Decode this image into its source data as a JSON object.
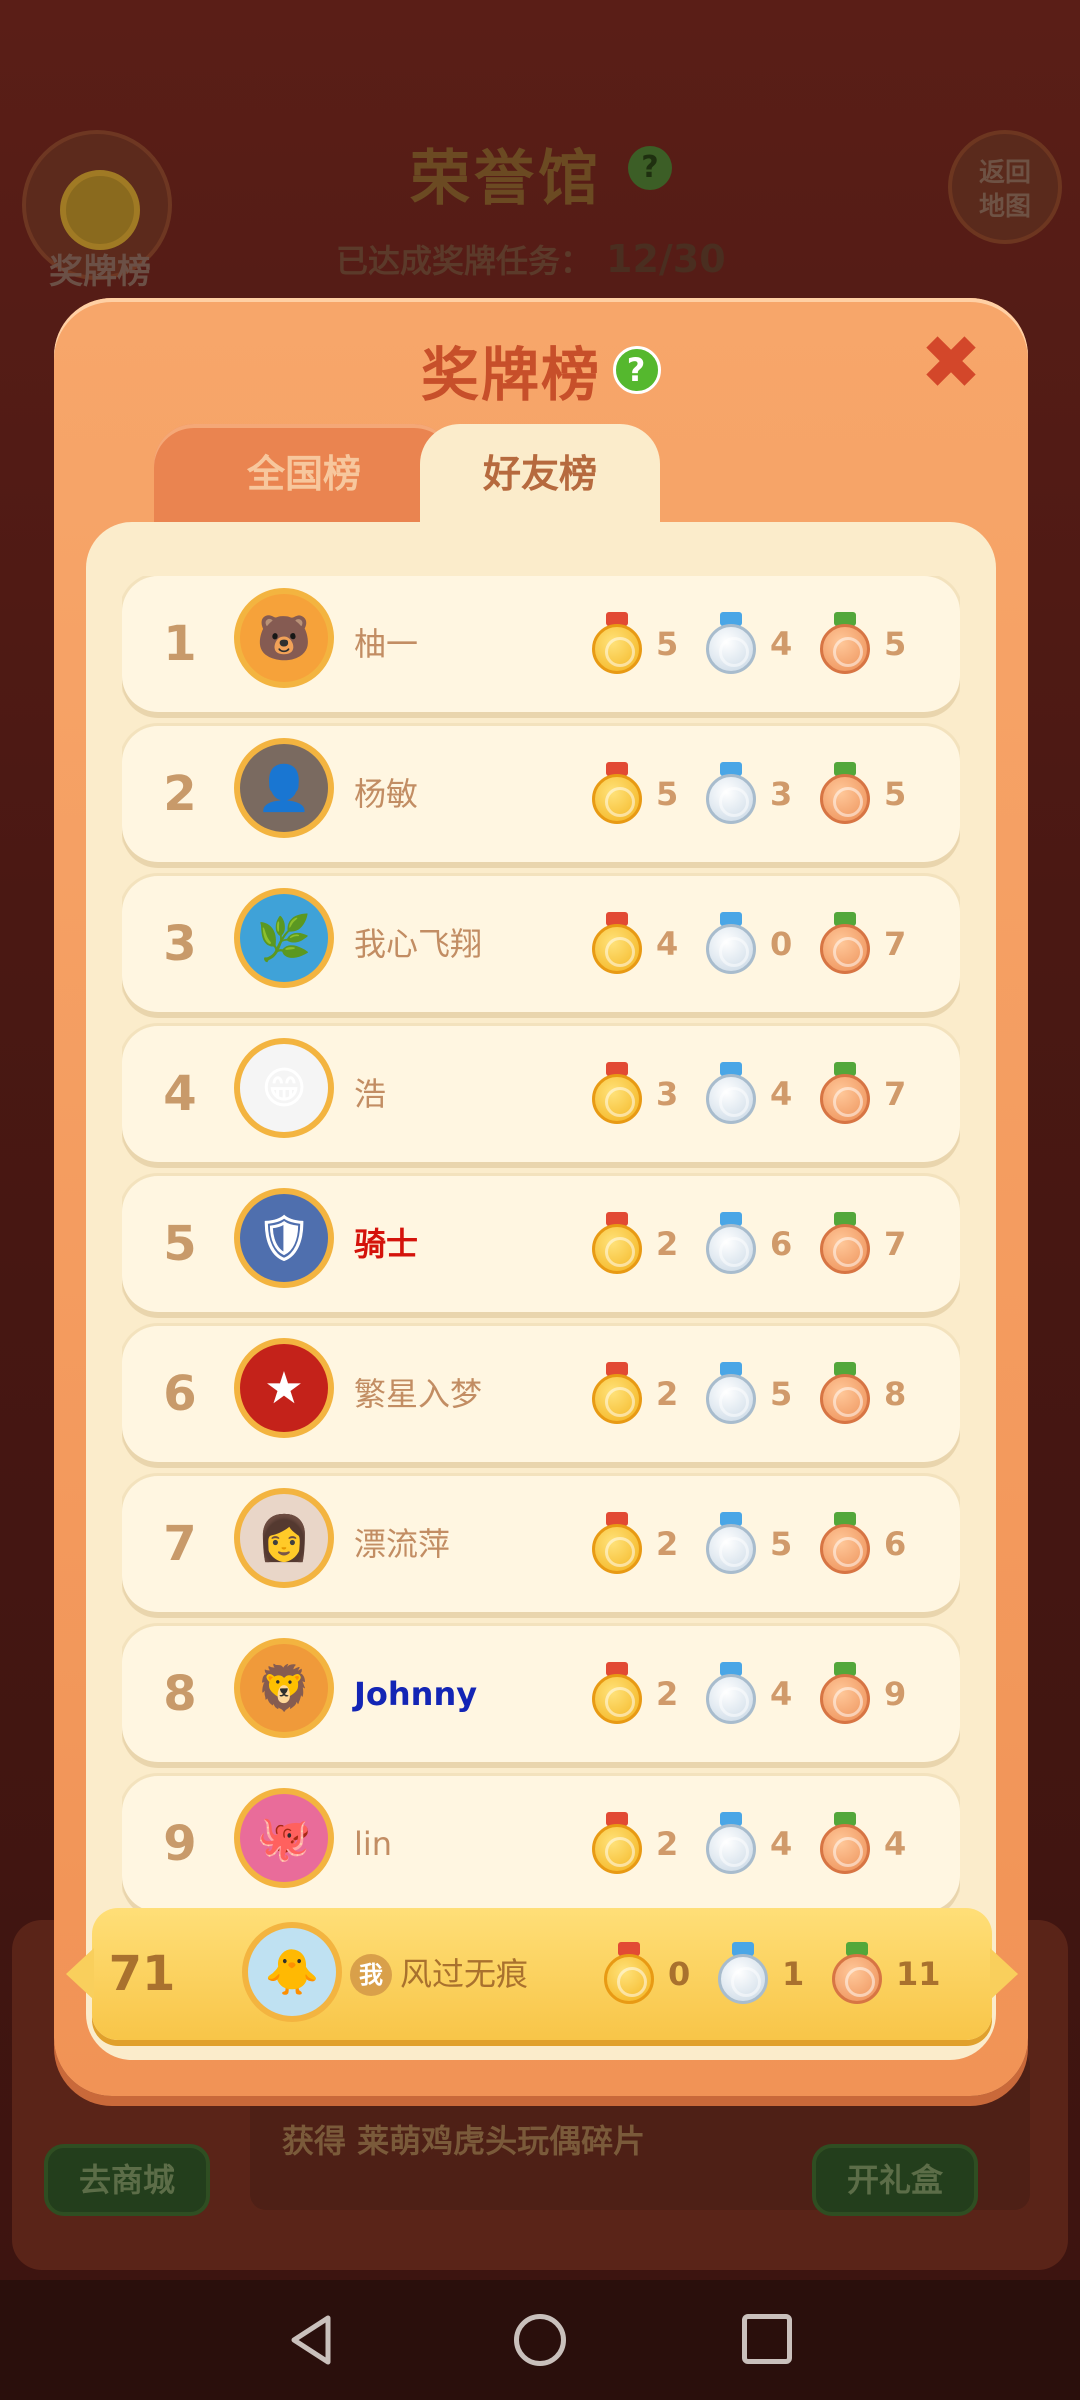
{
  "background": {
    "left_badge_label": "奖牌榜",
    "title": "荣誉馆",
    "title_help": "?",
    "progress_label": "已达成奖牌任务：",
    "progress_value": "12/30",
    "return_line1": "返回",
    "return_line2": "地图",
    "gain_prefix": "获得",
    "gain_item": "莱萌鸡虎头玩偶碎片",
    "shop_button": "去商城",
    "gift_button": "开礼盒"
  },
  "modal": {
    "title": "奖牌榜",
    "help": "?",
    "close": "✖",
    "tabs": [
      {
        "label": "全国榜",
        "active": false
      },
      {
        "label": "好友榜",
        "active": true
      }
    ]
  },
  "rows": [
    {
      "rank": "1",
      "name": "柚一",
      "gold": "5",
      "silver": "4",
      "bronze": "5",
      "avatar_color": "#f6a23a",
      "avatar_text": "🐻"
    },
    {
      "rank": "2",
      "name": "杨敏",
      "gold": "5",
      "silver": "3",
      "bronze": "5",
      "avatar_color": "#7a6a60",
      "avatar_text": "👤"
    },
    {
      "rank": "3",
      "name": "我心飞翔",
      "gold": "4",
      "silver": "0",
      "bronze": "7",
      "avatar_color": "#3fa2d8",
      "avatar_text": "🌿"
    },
    {
      "rank": "4",
      "name": "浩",
      "gold": "3",
      "silver": "4",
      "bronze": "7",
      "avatar_color": "#f5f5f5",
      "avatar_text": "😁"
    },
    {
      "rank": "5",
      "name": "骑士",
      "gold": "2",
      "silver": "6",
      "bronze": "7",
      "avatar_color": "#4f6fae",
      "avatar_text": "🛡"
    },
    {
      "rank": "6",
      "name": "繁星入梦",
      "gold": "2",
      "silver": "5",
      "bronze": "8",
      "avatar_color": "#c4221a",
      "avatar_text": "★"
    },
    {
      "rank": "7",
      "name": "漂流萍",
      "gold": "2",
      "silver": "5",
      "bronze": "6",
      "avatar_color": "#e9d6c8",
      "avatar_text": "👩"
    },
    {
      "rank": "8",
      "name": "Johnny",
      "gold": "2",
      "silver": "4",
      "bronze": "9",
      "avatar_color": "#f09a3a",
      "avatar_text": "🦁"
    },
    {
      "rank": "9",
      "name": "lin",
      "gold": "2",
      "silver": "4",
      "bronze": "4",
      "avatar_color": "#e96c9a",
      "avatar_text": "🐙"
    }
  ],
  "me": {
    "rank": "71",
    "tag": "我",
    "name": "风过无痕",
    "gold": "0",
    "silver": "1",
    "bronze": "11",
    "avatar_color": "#bfe1f2",
    "avatar_text": "🐥"
  },
  "colors": {
    "gold": "#f3b21c",
    "silver": "#c6d6e4",
    "bronze": "#ec8d54",
    "modal": "#f19356",
    "panel": "#fbeccb"
  }
}
